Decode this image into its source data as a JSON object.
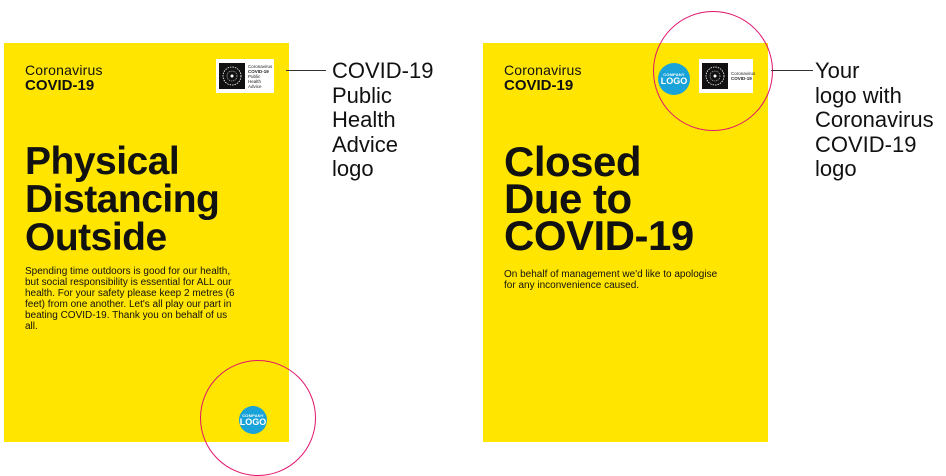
{
  "left_poster": {
    "brand_small": "Coronavirus",
    "brand_big": "COVID-19",
    "headline_lines": [
      "Physical",
      "Distancing",
      "Outside"
    ],
    "body": "Spending time outdoors is good for our health, but social responsibility is essential for ALL our health. For your safety please keep 2 metres (6 feet) from one another. Let's all play our part in beating COVID-19. Thank you on behalf of us all.",
    "gov_logo_lines": [
      "Coronavirus",
      "COVID-19",
      "Public Health",
      "Advice"
    ],
    "company_logo_top": "COMPANY",
    "company_logo_bottom": "LOGO"
  },
  "right_poster": {
    "brand_small": "Coronavirus",
    "brand_big": "COVID-19",
    "headline_lines": [
      "Closed",
      "Due to",
      "COVID-19"
    ],
    "body": "On behalf of management we'd like to apologise for any inconvenience caused.",
    "gov_logo_lines": [
      "Coronavirus",
      "COVID-19"
    ],
    "company_logo_top": "COMPANY",
    "company_logo_bottom": "LOGO"
  },
  "callouts": {
    "left_lines": [
      "COVID-19",
      "Public",
      "Health",
      "Advice",
      "logo"
    ],
    "right_lines": [
      "Your",
      "logo with",
      "Coronavirus",
      "COVID-19",
      "logo"
    ]
  },
  "colors": {
    "poster_yellow": "#ffe500",
    "highlight_ring": "#e0156d",
    "company_logo_blue": "#1aa3d9"
  }
}
